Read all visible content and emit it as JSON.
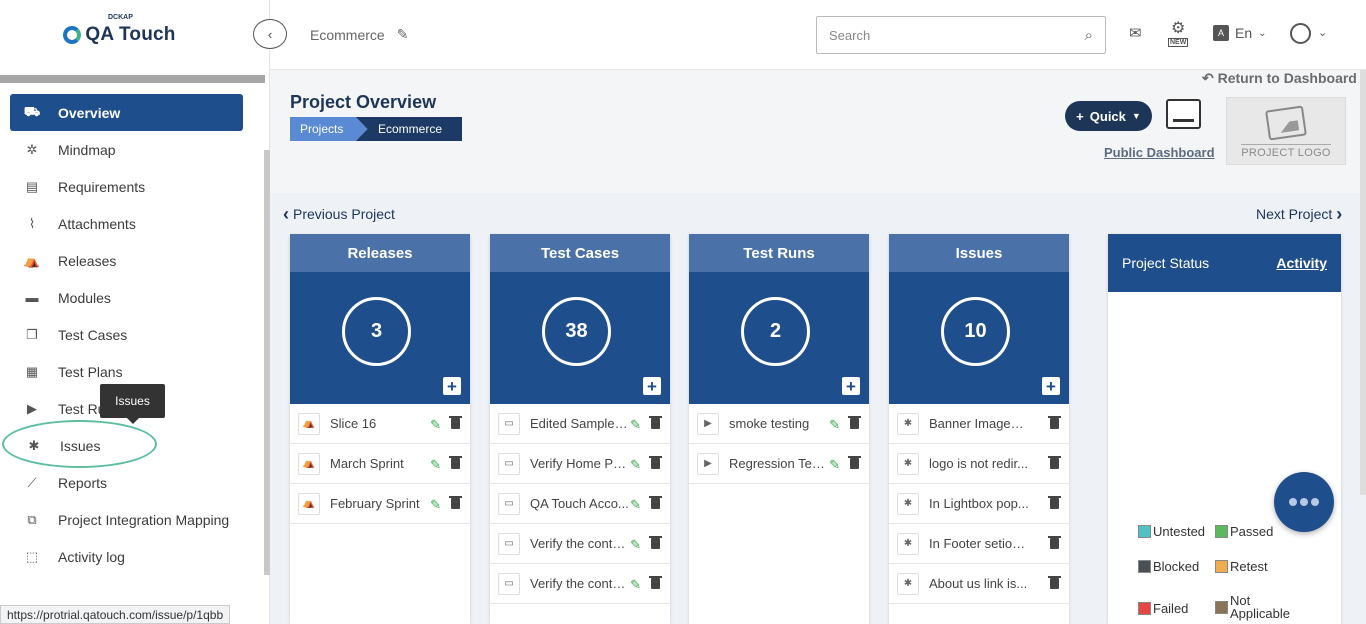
{
  "brand": {
    "name": "QA Touch",
    "small": "DCKAP"
  },
  "sidebar": {
    "items": [
      {
        "label": "Overview",
        "icon": "binoculars-icon",
        "active": true
      },
      {
        "label": "Mindmap",
        "icon": "mindmap-icon"
      },
      {
        "label": "Requirements",
        "icon": "requirements-icon"
      },
      {
        "label": "Attachments",
        "icon": "paperclip-icon"
      },
      {
        "label": "Releases",
        "icon": "releases-icon"
      },
      {
        "label": "Modules",
        "icon": "modules-icon"
      },
      {
        "label": "Test Cases",
        "icon": "test-cases-icon"
      },
      {
        "label": "Test Plans",
        "icon": "test-plans-icon"
      },
      {
        "label": "Test Runs",
        "icon": "play-icon"
      },
      {
        "label": "Issues",
        "icon": "bug-icon"
      },
      {
        "label": "Reports",
        "icon": "chart-icon"
      },
      {
        "label": "Project Integration Mapping",
        "icon": "integration-icon"
      },
      {
        "label": "Activity log",
        "icon": "activity-icon"
      }
    ],
    "tooltip": "Issues"
  },
  "status_url": "https://protrial.qatouch.com/issue/p/1qbb",
  "header": {
    "project": "Ecommerce",
    "search_placeholder": "Search",
    "new_badge": "NEW",
    "lang": "En",
    "lang_icon_text": "A"
  },
  "overview": {
    "return_label": "Return to Dashboard",
    "title": "Project Overview",
    "breadcrumb": [
      "Projects",
      "Ecommerce"
    ],
    "quick_label": "Quick",
    "public_dashboard": "Public Dashboard",
    "logo_label": "PROJECT LOGO",
    "prev_label": "Previous Project",
    "next_label": "Next Project"
  },
  "cards": [
    {
      "title": "Releases",
      "count": "3",
      "icon": "releases-icon",
      "rows": [
        "Slice 16",
        "March Sprint",
        "February Sprint"
      ],
      "editable": true
    },
    {
      "title": "Test Cases",
      "count": "38",
      "icon": "document-icon",
      "rows": [
        "Edited Sample t...",
        "Verify Home Pa...",
        "QA Touch Acco...",
        "Verify the conte...",
        "Verify the conte..."
      ],
      "editable": true
    },
    {
      "title": "Test Runs",
      "count": "2",
      "icon": "play-icon",
      "rows": [
        "smoke testing",
        "Regression Tes..."
      ],
      "editable": true
    },
    {
      "title": "Issues",
      "count": "10",
      "icon": "bug-icon",
      "rows": [
        "Banner Images ...",
        "logo is not redir...",
        "In Lightbox pop...",
        "In Footer setion...",
        "About us link is..."
      ],
      "editable": false
    }
  ],
  "project_status": {
    "title": "Project Status",
    "activity": "Activity",
    "legend": [
      {
        "label": "Untested",
        "color": "#4fc3c3"
      },
      {
        "label": "Passed",
        "color": "#5cb85c"
      },
      {
        "label": "Blocked",
        "color": "#4a4f55"
      },
      {
        "label": "Retest",
        "color": "#f0ad4e"
      },
      {
        "label": "Failed",
        "color": "#e84545"
      },
      {
        "label": "Not Applicable",
        "color": "#8b7355"
      }
    ]
  },
  "colors": {
    "primary": "#1f4e8c",
    "header_card": "#4a72a8",
    "accent_green": "#3aa94a"
  }
}
